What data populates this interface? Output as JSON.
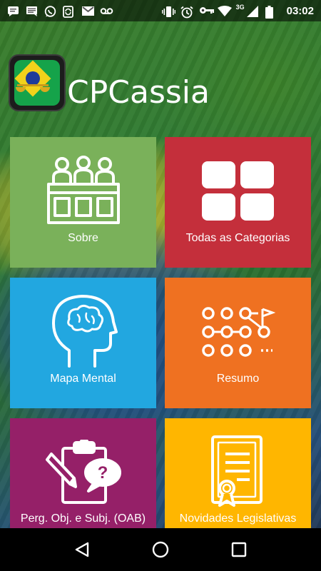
{
  "status_bar": {
    "time": "03:02",
    "network": "3G",
    "left_icons": [
      "sms-icon",
      "chat-icon",
      "whatsapp-icon",
      "sync-icon",
      "gmail-icon",
      "voicemail-icon"
    ],
    "right_icons": [
      "vibrate-icon",
      "alarm-icon",
      "vpn-key-icon",
      "wifi-icon",
      "signal-icon",
      "battery-icon"
    ]
  },
  "header": {
    "title": "CPCassia",
    "logo_icon": "brazil-justice-logo"
  },
  "tiles": [
    {
      "label": "Sobre",
      "icon": "court-panel-icon",
      "color": "#7ab15a"
    },
    {
      "label": "Todas as Categorias",
      "icon": "grid-icon",
      "color": "#c42f3b"
    },
    {
      "label": "Mapa Mental",
      "icon": "brain-head-icon",
      "color": "#22a7e0"
    },
    {
      "label": "Resumo",
      "icon": "dots-flag-path-icon",
      "color": "#ef7121"
    },
    {
      "label": "Perg. Obj. e Subj. (OAB)",
      "icon": "clipboard-question-icon",
      "color": "#952068"
    },
    {
      "label": "Novidades Legislativas",
      "icon": "certificate-icon",
      "color": "#ffb600"
    }
  ],
  "nav": {
    "back_icon": "back-triangle-icon",
    "home_icon": "home-circle-icon",
    "recents_icon": "recents-square-icon"
  }
}
